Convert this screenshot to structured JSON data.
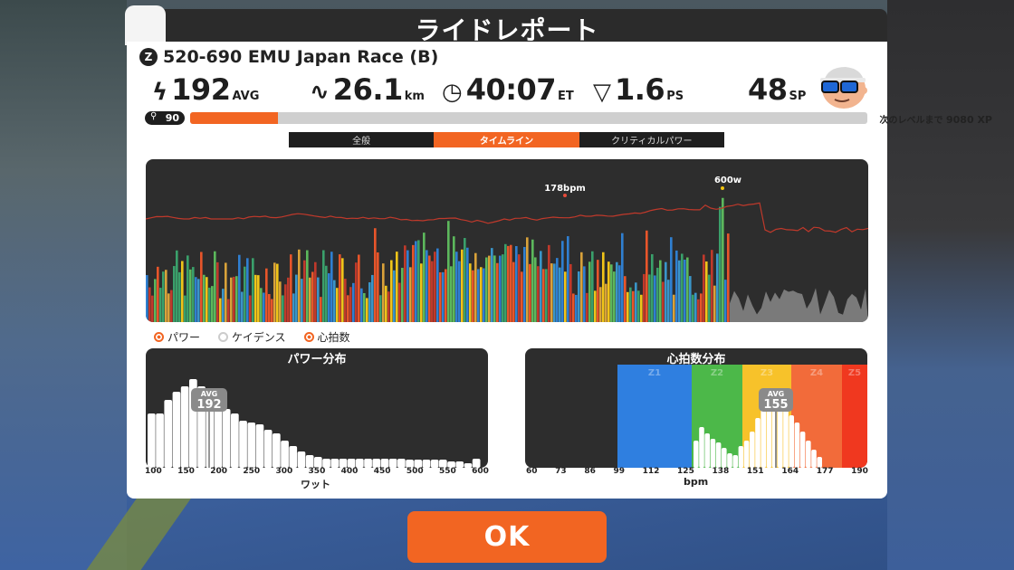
{
  "dialog": {
    "title": "ライドレポート"
  },
  "race": {
    "icon_text": "Z",
    "name": "520-690   EMU Japan Race (B)"
  },
  "stats": {
    "power": {
      "value": "192",
      "unit": "AVG"
    },
    "distance": {
      "value": "26.1",
      "unit": "km"
    },
    "time": {
      "value": "40:07",
      "unit": "ET"
    },
    "power_slice": {
      "value": "1.6",
      "unit": "PS"
    },
    "sport_points": {
      "value": "48",
      "unit": "SP"
    }
  },
  "level": {
    "value": "90",
    "progress": 0.13,
    "next_label": "次のレベルまで",
    "xp_remaining": "9080 XP"
  },
  "tabs": [
    {
      "label": "全般",
      "active": false
    },
    {
      "label": "タイムライン",
      "active": true
    },
    {
      "label": "クリティカルパワー",
      "active": false
    }
  ],
  "timeline": {
    "hr_peak_label": "178bpm",
    "power_peak_label": "600w"
  },
  "legend": [
    {
      "label": "パワー",
      "on": true
    },
    {
      "label": "ケイデンス",
      "on": false
    },
    {
      "label": "心拍数",
      "on": true
    }
  ],
  "power_dist": {
    "title": "パワー分布",
    "avg_label": "AVG",
    "avg_value": "192",
    "ticks": [
      "100",
      "150",
      "200",
      "250",
      "300",
      "350",
      "400",
      "450",
      "500",
      "550",
      "600"
    ],
    "xlabel": "ワット"
  },
  "hr_dist": {
    "title": "心拍数分布",
    "avg_label": "AVG",
    "avg_value": "155",
    "ticks": [
      "60",
      "73",
      "86",
      "99",
      "112",
      "125",
      "138",
      "151",
      "164",
      "177",
      "190"
    ],
    "zones": [
      "Z1",
      "Z2",
      "Z3",
      "Z4",
      "Z5"
    ],
    "xlabel": "bpm"
  },
  "ok_button": "OK",
  "colors": {
    "accent": "#f26522",
    "panel": "#ffffff",
    "dark": "#2d2d2d"
  }
}
